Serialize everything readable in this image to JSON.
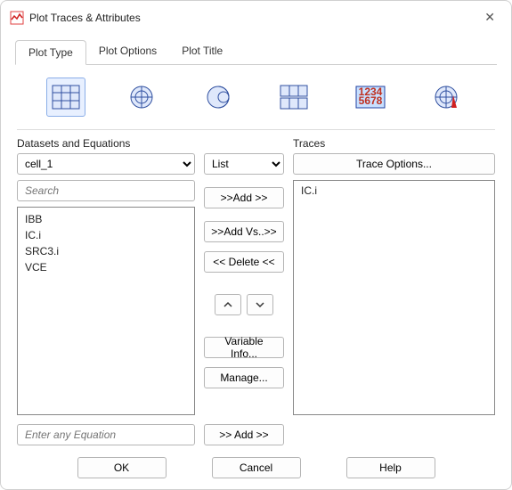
{
  "window": {
    "title": "Plot Traces & Attributes"
  },
  "tabs": {
    "plot_type": "Plot Type",
    "plot_options": "Plot Options",
    "plot_title": "Plot Title"
  },
  "sections": {
    "datasets": "Datasets and Equations",
    "traces": "Traces"
  },
  "datasets": {
    "selected": "cell_1",
    "search_placeholder": "Search",
    "mode": "List",
    "items": [
      "IBB",
      "IC.i",
      "SRC3.i",
      "VCE"
    ]
  },
  "buttons": {
    "trace_options": "Trace Options...",
    "add": ">>Add >>",
    "add_vs": ">>Add Vs..>>",
    "delete": "<< Delete <<",
    "up": "⌃",
    "down": "⌄",
    "var_info": "Variable Info...",
    "manage": "Manage...",
    "add_eq": ">> Add >>",
    "ok": "OK",
    "cancel": "Cancel",
    "help": "Help"
  },
  "traces": {
    "items": [
      "IC.i"
    ]
  },
  "equation": {
    "placeholder": "Enter any Equation"
  }
}
